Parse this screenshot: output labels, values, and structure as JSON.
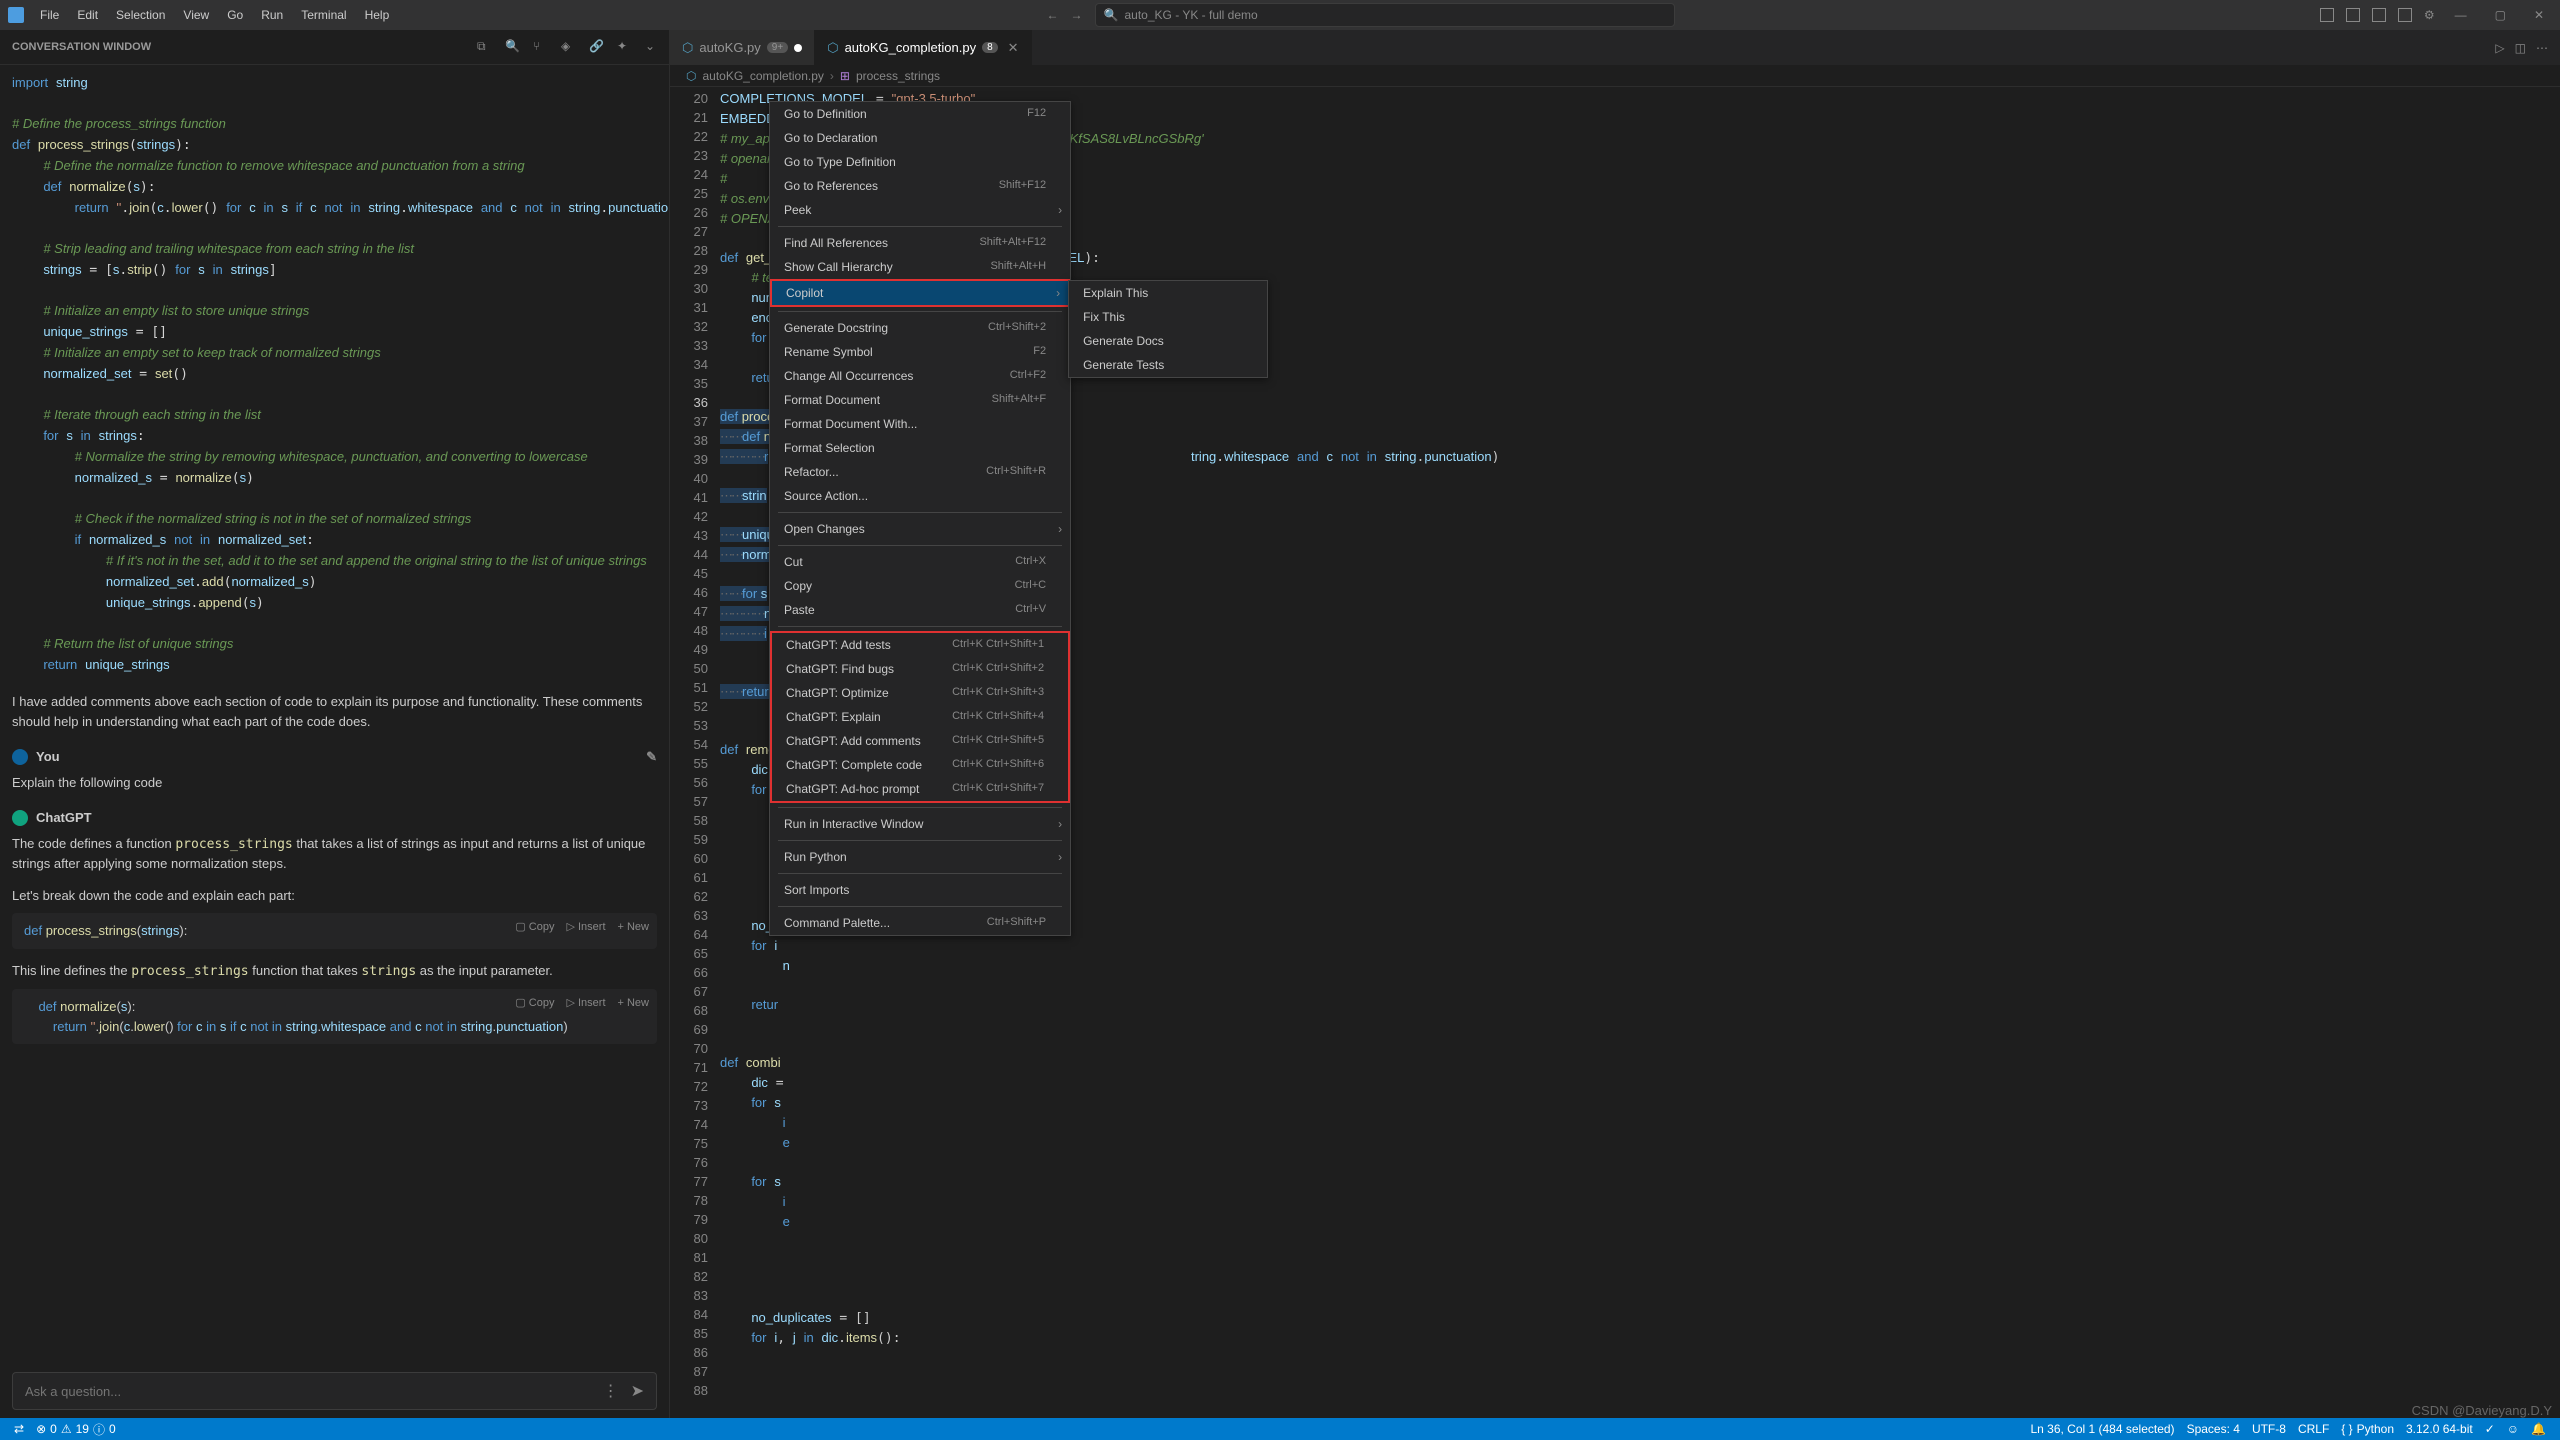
{
  "titlebar": {
    "menus": [
      "File",
      "Edit",
      "Selection",
      "View",
      "Go",
      "Run",
      "Terminal",
      "Help"
    ],
    "search_placeholder": "auto_KG - YK - full demo"
  },
  "conversation": {
    "title": "CONVERSATION WINDOW",
    "assistant_msg": "I have added comments above each section of code to explain its purpose and functionality. These comments should help in understanding what each part of the code does.",
    "you_label": "You",
    "user_msg": "Explain the following code",
    "chatgpt_label": "ChatGPT",
    "gpt_intro_prefix": "The code defines a function ",
    "gpt_intro_func": "process_strings",
    "gpt_intro_suffix": " that takes a list of strings as input and returns a list of unique strings after applying some normalization steps.",
    "gpt_breakdown": "Let's break down the code and explain each part:",
    "line_defines_prefix": "This line defines the ",
    "line_defines_func": "process_strings",
    "line_defines_mid": " function that takes ",
    "line_defines_param": "strings",
    "line_defines_suffix": " as the input parameter.",
    "copy": "Copy",
    "insert": "Insert",
    "new": "+ New",
    "input_placeholder": "Ask a question..."
  },
  "tabs": {
    "tab1": "autoKG.py",
    "tab1_badge": "9+",
    "tab2": "autoKG_completion.py",
    "tab2_badge": "8"
  },
  "breadcrumb": {
    "file": "autoKG_completion.py",
    "symbol": "process_strings"
  },
  "editor": {
    "line_start": 20,
    "line_end": 88,
    "current_line": 36
  },
  "context_menu": {
    "go_def": "Go to Definition",
    "go_def_key": "F12",
    "go_decl": "Go to Declaration",
    "go_type": "Go to Type Definition",
    "go_refs": "Go to References",
    "go_refs_key": "Shift+F12",
    "peek": "Peek",
    "find_refs": "Find All References",
    "find_refs_key": "Shift+Alt+F12",
    "call_hier": "Show Call Hierarchy",
    "call_hier_key": "Shift+Alt+H",
    "copilot": "Copilot",
    "gen_doc": "Generate Docstring",
    "gen_doc_key": "Ctrl+Shift+2",
    "rename": "Rename Symbol",
    "rename_key": "F2",
    "change_all": "Change All Occurrences",
    "change_all_key": "Ctrl+F2",
    "fmt_doc": "Format Document",
    "fmt_doc_key": "Shift+Alt+F",
    "fmt_with": "Format Document With...",
    "fmt_sel": "Format Selection",
    "refactor": "Refactor...",
    "refactor_key": "Ctrl+Shift+R",
    "src_action": "Source Action...",
    "open_changes": "Open Changes",
    "cut": "Cut",
    "cut_key": "Ctrl+X",
    "copy": "Copy",
    "copy_key": "Ctrl+C",
    "paste": "Paste",
    "paste_key": "Ctrl+V",
    "gpt_tests": "ChatGPT: Add tests",
    "gpt_tests_key": "Ctrl+K Ctrl+Shift+1",
    "gpt_bugs": "ChatGPT: Find bugs",
    "gpt_bugs_key": "Ctrl+K Ctrl+Shift+2",
    "gpt_opt": "ChatGPT: Optimize",
    "gpt_opt_key": "Ctrl+K Ctrl+Shift+3",
    "gpt_explain": "ChatGPT: Explain",
    "gpt_explain_key": "Ctrl+K Ctrl+Shift+4",
    "gpt_comments": "ChatGPT: Add comments",
    "gpt_comments_key": "Ctrl+K Ctrl+Shift+5",
    "gpt_complete": "ChatGPT: Complete code",
    "gpt_complete_key": "Ctrl+K Ctrl+Shift+6",
    "gpt_adhoc": "ChatGPT: Ad-hoc prompt",
    "gpt_adhoc_key": "Ctrl+K Ctrl+Shift+7",
    "run_interactive": "Run in Interactive Window",
    "run_python": "Run Python",
    "sort_imports": "Sort Imports",
    "cmd_palette": "Command Palette...",
    "cmd_palette_key": "Ctrl+Shift+P"
  },
  "copilot_submenu": {
    "explain": "Explain This",
    "fix": "Fix This",
    "docs": "Generate Docs",
    "tests": "Generate Tests"
  },
  "statusbar": {
    "errors": "0",
    "warnings": "19",
    "hints": "0",
    "position": "Ln 36, Col 1 (484 selected)",
    "spaces": "Spaces: 4",
    "encoding": "UTF-8",
    "eol": "CRLF",
    "language": "Python",
    "interpreter": "3.12.0 64-bit"
  },
  "watermark": "CSDN @Davieyang.D.Y"
}
